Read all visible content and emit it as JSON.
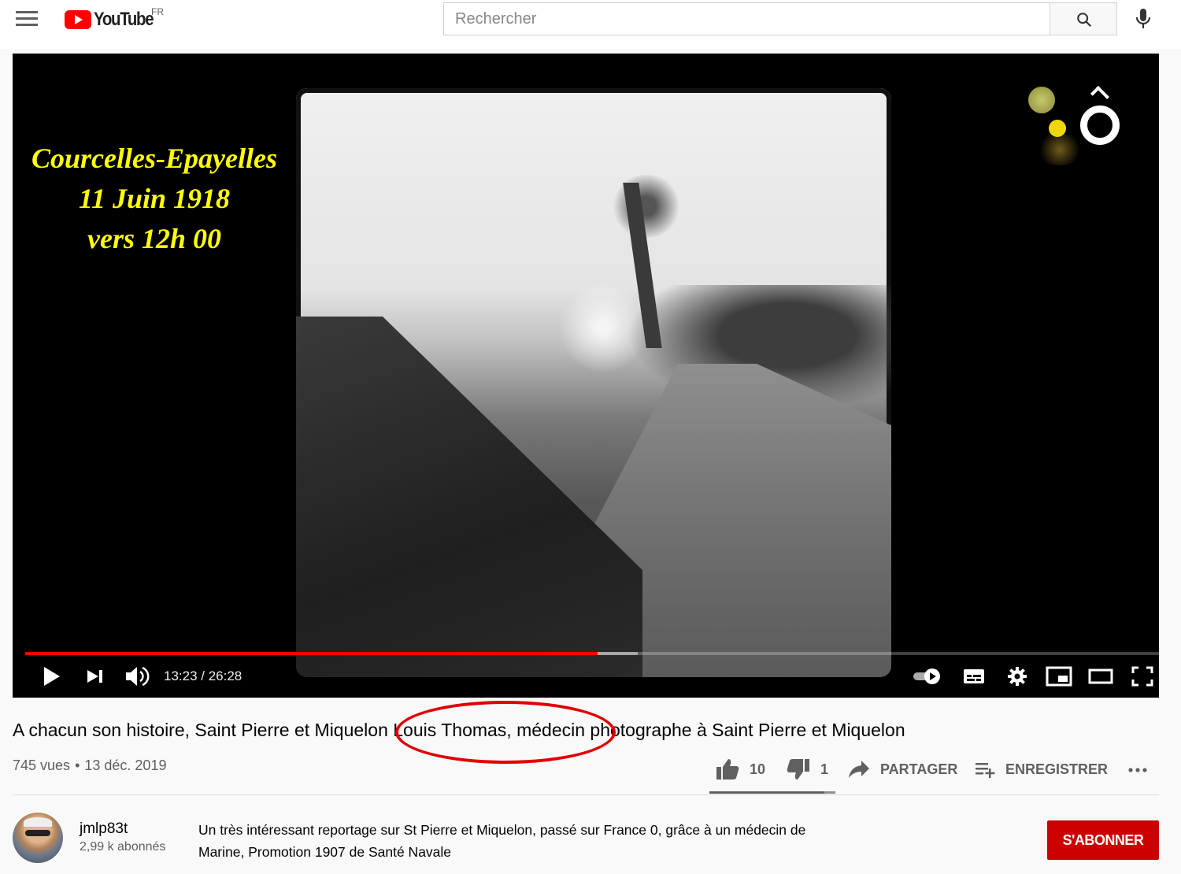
{
  "masthead": {
    "logo_text": "YouTube",
    "country_code": "FR",
    "search_placeholder": "Rechercher"
  },
  "player": {
    "overlay_lines": [
      "Courcelles-Epayelles",
      "11 Juin 1918",
      "vers 12h 00"
    ],
    "current_time": "13:23",
    "duration": "26:28",
    "time_display": "13:23 / 26:28",
    "progress_fraction": 0.505,
    "buffer_fraction": 0.54,
    "accent_color": "#ff0000"
  },
  "video": {
    "title": "A chacun son histoire, Saint Pierre et Miquelon Louis Thomas, médecin photographe à Saint Pierre et Miquelon",
    "views": "745 vues",
    "date": "13 déc. 2019",
    "likes": "10",
    "dislikes": "1",
    "share_label": "PARTAGER",
    "save_label": "ENREGISTRER"
  },
  "channel": {
    "name": "jmlp83t",
    "subscribers": "2,99 k abonnés",
    "subscribe_label": "S'ABONNER",
    "subscribe_color": "#cc0000"
  },
  "description": {
    "line1": "Un très intéressant reportage sur St Pierre et Miquelon, passé sur France 0, grâce à un médecin de",
    "line2": "Marine, Promotion 1907 de Santé Navale"
  },
  "icons": [
    "menu-icon",
    "youtube-logo-icon",
    "search-icon",
    "mic-icon",
    "play-icon",
    "next-icon",
    "volume-icon",
    "autoplay-toggle-icon",
    "subtitles-icon",
    "settings-icon",
    "miniplayer-icon",
    "theater-mode-icon",
    "fullscreen-icon",
    "like-icon",
    "dislike-icon",
    "share-icon",
    "save-playlist-icon",
    "more-icon"
  ]
}
